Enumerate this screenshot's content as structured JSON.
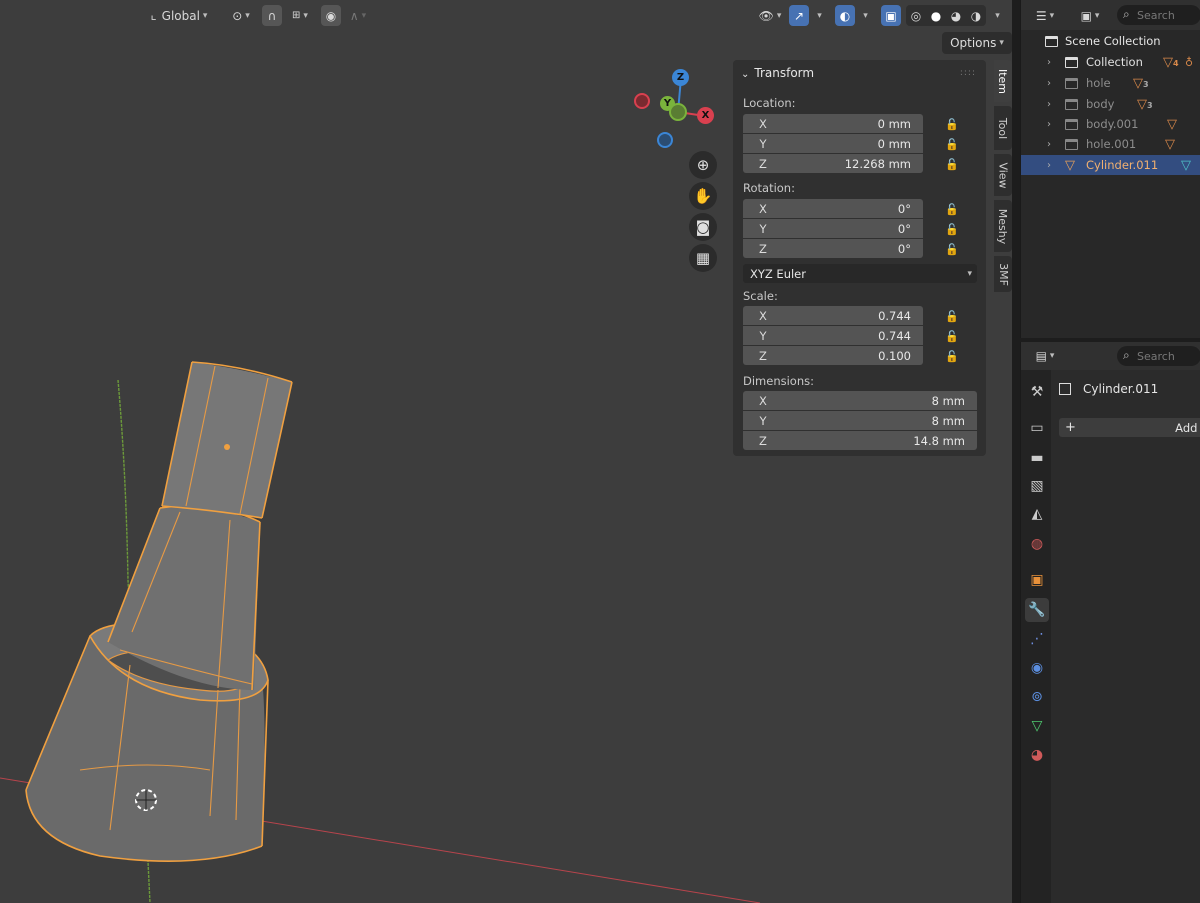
{
  "header": {
    "transform_orientation": "Global",
    "options_label": "Options"
  },
  "gizmo": {
    "z": "Z",
    "y": "Y",
    "x": "X"
  },
  "n_tabs": [
    "Item",
    "Tool",
    "View",
    "Meshy",
    "3MF"
  ],
  "transform": {
    "title": "Transform",
    "location_label": "Location:",
    "location": [
      {
        "axis": "X",
        "value": "0 mm"
      },
      {
        "axis": "Y",
        "value": "0 mm"
      },
      {
        "axis": "Z",
        "value": "12.268 mm"
      }
    ],
    "rotation_label": "Rotation:",
    "rotation": [
      {
        "axis": "X",
        "value": "0°"
      },
      {
        "axis": "Y",
        "value": "0°"
      },
      {
        "axis": "Z",
        "value": "0°"
      }
    ],
    "rotation_mode": "XYZ Euler",
    "scale_label": "Scale:",
    "scale": [
      {
        "axis": "X",
        "value": "0.744"
      },
      {
        "axis": "Y",
        "value": "0.744"
      },
      {
        "axis": "Z",
        "value": "0.100"
      }
    ],
    "dimensions_label": "Dimensions:",
    "dimensions": [
      {
        "axis": "X",
        "value": "8 mm"
      },
      {
        "axis": "Y",
        "value": "8 mm"
      },
      {
        "axis": "Z",
        "value": "14.8 mm"
      }
    ]
  },
  "outliner": {
    "search_placeholder": "Search",
    "scene_collection": "Scene Collection",
    "items": [
      {
        "name": "Collection",
        "badge": "4"
      },
      {
        "name": "hole",
        "badge": "3"
      },
      {
        "name": "body",
        "badge": "3"
      },
      {
        "name": "body.001",
        "badge": ""
      },
      {
        "name": "hole.001",
        "badge": ""
      },
      {
        "name": "Cylinder.011",
        "badge": ""
      }
    ]
  },
  "properties": {
    "search_placeholder": "Search",
    "object_name": "Cylinder.011",
    "add_modifier_label": "Add M"
  },
  "colors": {
    "selection_outline": "#f0a040",
    "x_axis": "#d9404f",
    "y_axis": "#7ab33c",
    "z_axis": "#3b86d6",
    "active_row": "#334d80"
  }
}
